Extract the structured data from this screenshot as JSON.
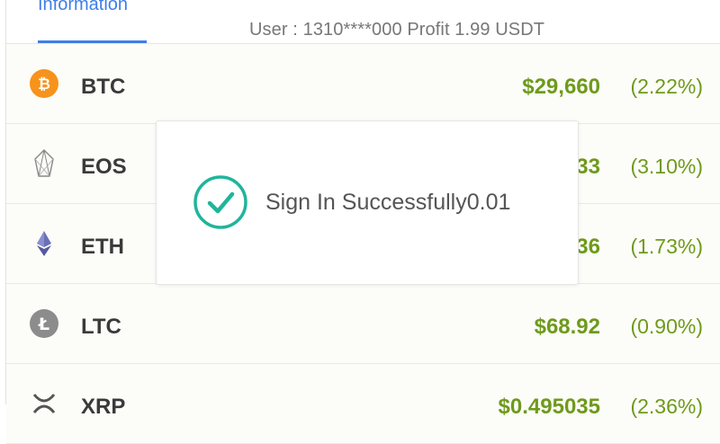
{
  "tab": {
    "label": "Information"
  },
  "user_line": "User : 1310****000 Profit 1.99 USDT",
  "colors": {
    "accent": "#3f7fe6",
    "price_green": "#6e9a1c",
    "success": "#1fb59b"
  },
  "coins": [
    {
      "symbol": "BTC",
      "price": "$29,660",
      "change": "(2.22%)",
      "icon": "bitcoin-icon"
    },
    {
      "symbol": "EOS",
      "price": "33",
      "change": "(3.10%)",
      "icon": "eos-icon"
    },
    {
      "symbol": "ETH",
      "price": "36",
      "change": "(1.73%)",
      "icon": "ethereum-icon"
    },
    {
      "symbol": "LTC",
      "price": "$68.92",
      "change": "(0.90%)",
      "icon": "litecoin-icon"
    },
    {
      "symbol": "XRP",
      "price": "$0.495035",
      "change": "(2.36%)",
      "icon": "xrp-icon"
    }
  ],
  "toast": {
    "message": "Sign In Successfully0.01",
    "icon": "check-circle-icon"
  }
}
